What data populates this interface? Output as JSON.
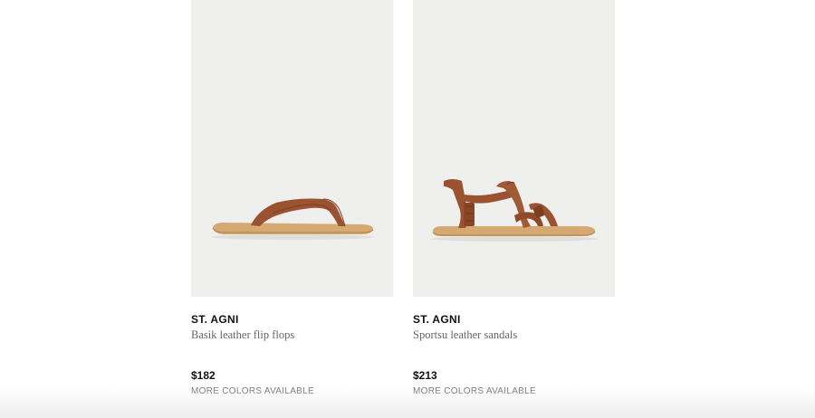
{
  "products": [
    {
      "brand": "ST. AGNI",
      "name": "Basik leather flip flops",
      "price": "$182",
      "availability": "MORE COLORS AVAILABLE",
      "image": "flip-flop-sandal"
    },
    {
      "brand": "ST. AGNI",
      "name": "Sportsu leather sandals",
      "price": "$213",
      "availability": "MORE COLORS AVAILABLE",
      "image": "strappy-sport-sandal"
    }
  ],
  "colors": {
    "image_background": "#efefed",
    "leather": "#9a5230",
    "sole": "#d6a872"
  }
}
